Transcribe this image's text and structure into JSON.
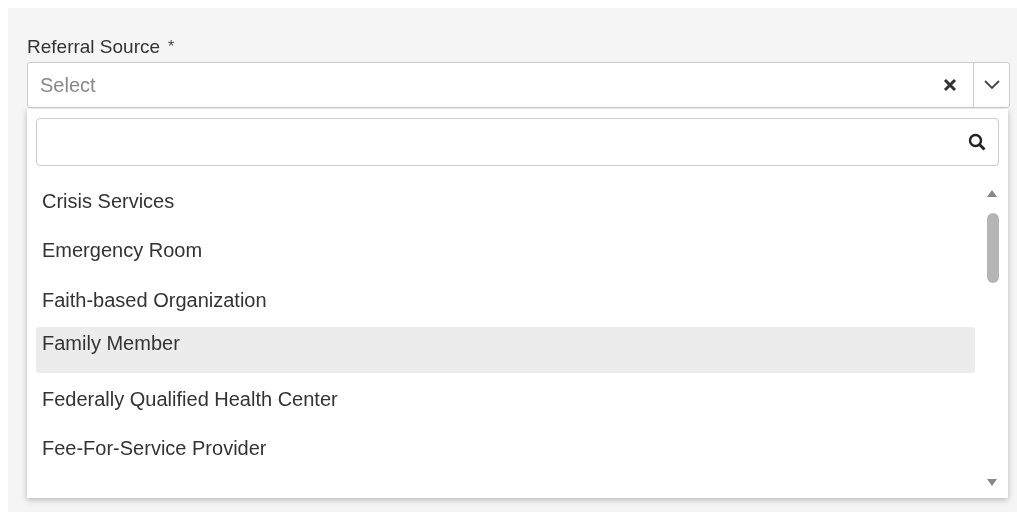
{
  "field": {
    "label": "Referral Source",
    "required_mark": "*",
    "placeholder": "Select"
  },
  "dropdown": {
    "options": [
      {
        "label": "Crisis Services",
        "selected": false
      },
      {
        "label": "Emergency Room",
        "selected": false
      },
      {
        "label": "Faith-based Organization",
        "selected": false
      },
      {
        "label": "Family Member",
        "selected": true
      },
      {
        "label": "Federally Qualified Health Center",
        "selected": false
      },
      {
        "label": "Fee-For-Service Provider",
        "selected": false
      }
    ]
  }
}
